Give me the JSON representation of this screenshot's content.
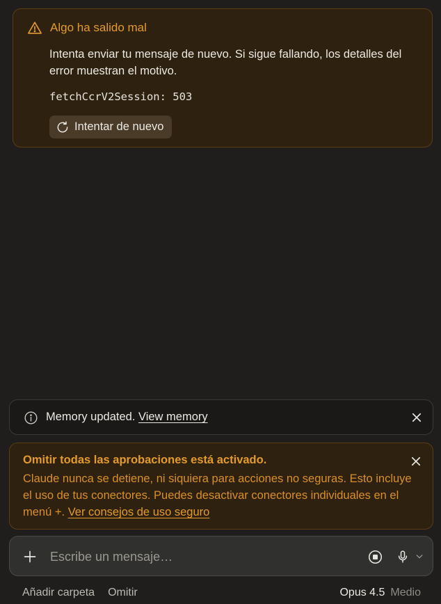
{
  "error": {
    "title": "Algo ha salido mal",
    "message": "Intenta enviar tu mensaje de nuevo. Si sigue fallando, los detalles del error muestran el motivo.",
    "code": "fetchCcrV2Session: 503",
    "retry_label": "Intentar de nuevo",
    "accent": "#e39b2c"
  },
  "memory": {
    "text": "Memory updated.",
    "link": "View memory"
  },
  "warning": {
    "title": "Omitir todas las aprobaciones está activado.",
    "body": "Claude nunca se detiene, ni siquiera para acciones no seguras. Esto incluye el uso de tus conectores. Puedes desactivar conectores individuales en el menú",
    "menu_symbol": "+",
    "period": ".",
    "link": "Ver consejos de uso seguro"
  },
  "composer": {
    "placeholder": "Escribe un mensaje…"
  },
  "footer": {
    "add_folder": "Añadir carpeta",
    "skip": "Omitir",
    "model": "Opus 4.5",
    "effort": "Medio"
  },
  "icons": {
    "error": "warning-triangle-icon",
    "retry": "refresh-icon",
    "memory": "info-icon",
    "close": "close-icon",
    "add": "plus-icon",
    "stop": "stop-icon",
    "mic": "microphone-icon",
    "dropdown": "chevron-down-icon"
  }
}
